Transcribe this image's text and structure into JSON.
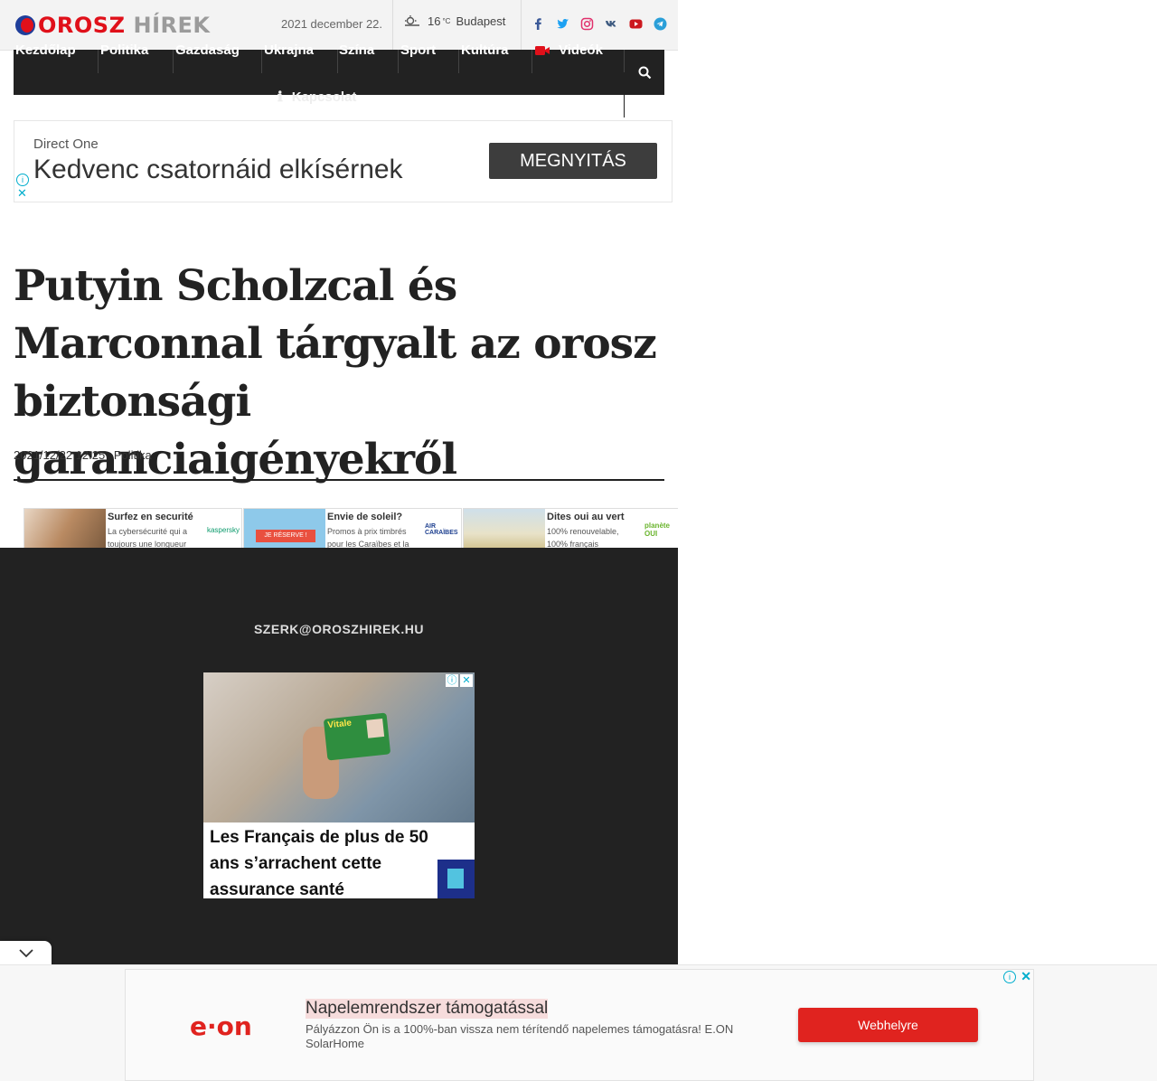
{
  "site": {
    "logo_part1": "OROSZ",
    "logo_part2": "HÍREK",
    "date": "2021 december 22."
  },
  "weather": {
    "temp": "16",
    "unit": "°C",
    "city": "Budapest",
    "icon": "partly-sunny-icon"
  },
  "social": [
    "facebook-icon",
    "twitter-icon",
    "instagram-icon",
    "vk-icon",
    "youtube-icon",
    "telegram-icon"
  ],
  "nav": {
    "items": [
      "Kezdőlap",
      "Politika",
      "Gazdaság",
      "Ukrajna",
      "Szína",
      "Sport",
      "Kultúra",
      "Videók"
    ],
    "contact": "Kapcsolat"
  },
  "ad_top": {
    "brand": "Direct One",
    "headline": "Kedvenc csatornáid elkísérnek",
    "button": "MEGNYITÁS"
  },
  "article": {
    "title": "Putyin Scholzcal és Marconnal tárgyalt az orosz biztonsági garanciaigényekről",
    "timestamp": "2021/12/22 12:25",
    "category": "Politika"
  },
  "ad_strip": [
    {
      "title": "Surfez en securité",
      "desc": "La cybersécurité qui a toujours une longueur",
      "logo": "kaspersky"
    },
    {
      "title": "Envie de soleil?",
      "desc": "Promos à prix timbrés pour les Caraïbes et la",
      "logo": "AIR CARAÏBES",
      "cta": "JE RÉSERVE !"
    },
    {
      "title": "Dites oui au vert",
      "desc": "100% renouvelable, 100% français",
      "logo": "planète OUI"
    }
  ],
  "footer": {
    "email": "SZERK@OROSZHIREK.HU"
  },
  "ad_mid": {
    "card_text": "Vitale",
    "caption": "Les Français de plus de 50 ans s’arrachent cette assurance santé"
  },
  "ad_bottom": {
    "logo": "e·on",
    "headline": "Napelemrendszer támogatással",
    "desc": "Pályázzon Ön is a 100%-ban vissza nem térítendő napelemes támogatásra! E.ON SolarHome",
    "button": "Webhelyre"
  }
}
